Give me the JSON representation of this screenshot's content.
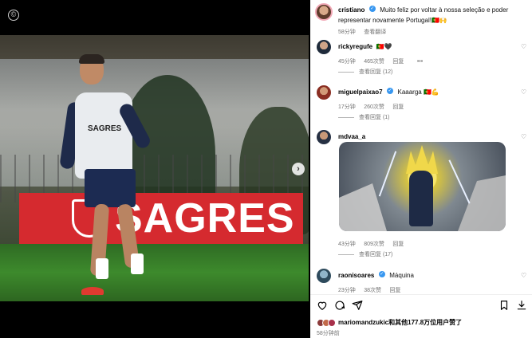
{
  "post": {
    "author": "cristiano",
    "caption": "Muito feliz por voltar à nossa seleção e poder representar novamente Portugal!🇵🇹🙌",
    "age": "58分钟",
    "translate_label": "查看翻译"
  },
  "comments": [
    {
      "username": "rickyregufe",
      "verified": false,
      "text": "🇵🇹🖤",
      "age": "45分钟",
      "likes": "465次赞",
      "reply_label": "回复",
      "more_label": "•••",
      "view_replies": "查看回复 (12)"
    },
    {
      "username": "miguelpaixao7",
      "verified": true,
      "text": "Kaaarga 🇵🇹💪",
      "age": "17分钟",
      "likes": "260次赞",
      "reply_label": "回复",
      "view_replies": "查看回复 (1)"
    },
    {
      "username": "mdvaa_a",
      "verified": false,
      "text": "",
      "age": "43分钟",
      "likes": "809次赞",
      "reply_label": "回复",
      "view_replies": "查看回复 (17)"
    },
    {
      "username": "raonisoares",
      "verified": true,
      "text": "Máquina",
      "age": "23分钟",
      "likes": "38次赞",
      "reply_label": "回复"
    }
  ],
  "likes": {
    "first_user": "mariomandzukic",
    "rest": "和其他177.8万位用户赞了"
  },
  "post_time": "58分钟前",
  "photo": {
    "billboard_text": "SAGRES",
    "vest_text": "SAGRES"
  },
  "icons": [
    "heart-icon",
    "comment-icon",
    "share-icon",
    "bookmark-icon",
    "download-icon",
    "next-arrow-icon",
    "watermark-icon"
  ],
  "colors": {
    "verified": "#3897f0",
    "meta": "#737373",
    "billboard": "#d52a2f"
  }
}
